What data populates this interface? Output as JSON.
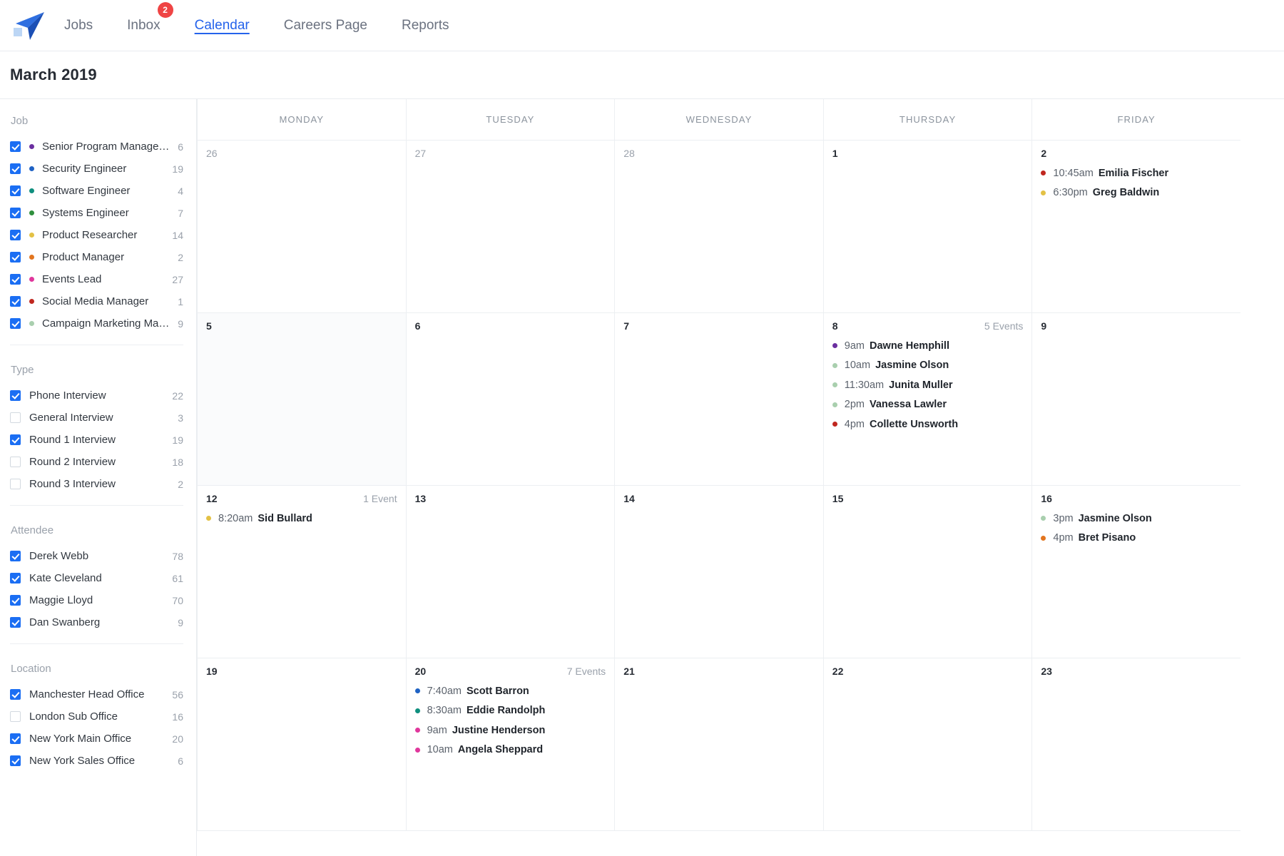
{
  "nav": {
    "logo_icon": "paper-plane-logo",
    "links": [
      {
        "label": "Jobs",
        "active": false,
        "badge": null
      },
      {
        "label": "Inbox",
        "active": false,
        "badge": "2"
      },
      {
        "label": "Calendar",
        "active": true,
        "badge": null
      },
      {
        "label": "Careers Page",
        "active": false,
        "badge": null
      },
      {
        "label": "Reports",
        "active": false,
        "badge": null
      }
    ]
  },
  "header": {
    "month_title": "March 2019"
  },
  "colors": {
    "accent": "#2563eb",
    "checkbox_on": "#1b6ef3",
    "badge_red": "#ef4444",
    "muted_text": "#9aa1ab"
  },
  "sidebar": {
    "groups": [
      {
        "title": "Job",
        "has_dots": true,
        "items": [
          {
            "label": "Senior Program Manage…",
            "count": "6",
            "checked": true,
            "dot": "#6b2fa0"
          },
          {
            "label": "Security Engineer",
            "count": "19",
            "checked": true,
            "dot": "#1f62c4"
          },
          {
            "label": "Software Engineer",
            "count": "4",
            "checked": true,
            "dot": "#0f8f7e"
          },
          {
            "label": "Systems Engineer",
            "count": "7",
            "checked": true,
            "dot": "#2f8f3d"
          },
          {
            "label": "Product Researcher",
            "count": "14",
            "checked": true,
            "dot": "#e3c145"
          },
          {
            "label": "Product Manager",
            "count": "2",
            "checked": true,
            "dot": "#e2751f"
          },
          {
            "label": "Events Lead",
            "count": "27",
            "checked": true,
            "dot": "#e0379c"
          },
          {
            "label": "Social Media Manager",
            "count": "1",
            "checked": true,
            "dot": "#c0271f"
          },
          {
            "label": "Campaign Marketing Ma…",
            "count": "9",
            "checked": true,
            "dot": "#a9cfae"
          }
        ]
      },
      {
        "title": "Type",
        "has_dots": false,
        "items": [
          {
            "label": "Phone Interview",
            "count": "22",
            "checked": true
          },
          {
            "label": "General Interview",
            "count": "3",
            "checked": false
          },
          {
            "label": "Round 1 Interview",
            "count": "19",
            "checked": true
          },
          {
            "label": "Round 2 Interview",
            "count": "18",
            "checked": false
          },
          {
            "label": "Round 3 Interview",
            "count": "2",
            "checked": false
          }
        ]
      },
      {
        "title": "Attendee",
        "has_dots": false,
        "items": [
          {
            "label": "Derek Webb",
            "count": "78",
            "checked": true
          },
          {
            "label": "Kate Cleveland",
            "count": "61",
            "checked": true
          },
          {
            "label": "Maggie Lloyd",
            "count": "70",
            "checked": true
          },
          {
            "label": "Dan Swanberg",
            "count": "9",
            "checked": true
          }
        ]
      },
      {
        "title": "Location",
        "has_dots": false,
        "items": [
          {
            "label": "Manchester Head Office",
            "count": "56",
            "checked": true
          },
          {
            "label": "London Sub Office",
            "count": "16",
            "checked": false
          },
          {
            "label": "New York Main Office",
            "count": "20",
            "checked": true
          },
          {
            "label": "New York Sales Office",
            "count": "6",
            "checked": true
          }
        ]
      }
    ]
  },
  "calendar": {
    "day_headers": [
      "MONDAY",
      "TUESDAY",
      "WEDNESDAY",
      "THURSDAY",
      "FRIDAY"
    ],
    "weeks": [
      [
        {
          "day": "26",
          "muted": true,
          "shaded": false,
          "count_label": "",
          "events": []
        },
        {
          "day": "27",
          "muted": true,
          "shaded": false,
          "count_label": "",
          "events": []
        },
        {
          "day": "28",
          "muted": true,
          "shaded": false,
          "count_label": "",
          "events": []
        },
        {
          "day": "1",
          "muted": false,
          "shaded": false,
          "count_label": "",
          "events": []
        },
        {
          "day": "2",
          "muted": false,
          "shaded": false,
          "count_label": "",
          "events": [
            {
              "time": "10:45am",
              "name": "Emilia Fischer",
              "dot": "#c0271f"
            },
            {
              "time": "6:30pm",
              "name": "Greg Baldwin",
              "dot": "#e3c145"
            }
          ]
        }
      ],
      [
        {
          "day": "5",
          "muted": false,
          "shaded": true,
          "count_label": "",
          "events": []
        },
        {
          "day": "6",
          "muted": false,
          "shaded": false,
          "count_label": "",
          "events": []
        },
        {
          "day": "7",
          "muted": false,
          "shaded": false,
          "count_label": "",
          "events": []
        },
        {
          "day": "8",
          "muted": false,
          "shaded": false,
          "count_label": "5 Events",
          "events": [
            {
              "time": "9am",
              "name": "Dawne Hemphill",
              "dot": "#6b2fa0"
            },
            {
              "time": "10am",
              "name": "Jasmine Olson",
              "dot": "#a9cfae"
            },
            {
              "time": "11:30am",
              "name": "Junita Muller",
              "dot": "#a9cfae"
            },
            {
              "time": "2pm",
              "name": "Vanessa Lawler",
              "dot": "#a9cfae"
            },
            {
              "time": "4pm",
              "name": "Collette Unsworth",
              "dot": "#c0271f"
            }
          ]
        },
        {
          "day": "9",
          "muted": false,
          "shaded": false,
          "count_label": "",
          "events": []
        }
      ],
      [
        {
          "day": "12",
          "muted": false,
          "shaded": false,
          "count_label": "1 Event",
          "events": [
            {
              "time": "8:20am",
              "name": "Sid Bullard",
              "dot": "#e3c145"
            }
          ]
        },
        {
          "day": "13",
          "muted": false,
          "shaded": false,
          "count_label": "",
          "events": []
        },
        {
          "day": "14",
          "muted": false,
          "shaded": false,
          "count_label": "",
          "events": []
        },
        {
          "day": "15",
          "muted": false,
          "shaded": false,
          "count_label": "",
          "events": []
        },
        {
          "day": "16",
          "muted": false,
          "shaded": false,
          "count_label": "",
          "events": [
            {
              "time": "3pm",
              "name": "Jasmine Olson",
              "dot": "#a9cfae"
            },
            {
              "time": "4pm",
              "name": "Bret Pisano",
              "dot": "#e2751f"
            }
          ]
        }
      ],
      [
        {
          "day": "19",
          "muted": false,
          "shaded": false,
          "count_label": "",
          "events": []
        },
        {
          "day": "20",
          "muted": false,
          "shaded": false,
          "count_label": "7 Events",
          "events": [
            {
              "time": "7:40am",
              "name": "Scott Barron",
              "dot": "#1f62c4"
            },
            {
              "time": "8:30am",
              "name": "Eddie Randolph",
              "dot": "#0f8f7e"
            },
            {
              "time": "9am",
              "name": "Justine Henderson",
              "dot": "#e0379c"
            },
            {
              "time": "10am",
              "name": "Angela Sheppard",
              "dot": "#e0379c"
            }
          ]
        },
        {
          "day": "21",
          "muted": false,
          "shaded": false,
          "count_label": "",
          "events": []
        },
        {
          "day": "22",
          "muted": false,
          "shaded": false,
          "count_label": "",
          "events": []
        },
        {
          "day": "23",
          "muted": false,
          "shaded": false,
          "count_label": "",
          "events": []
        }
      ]
    ]
  }
}
